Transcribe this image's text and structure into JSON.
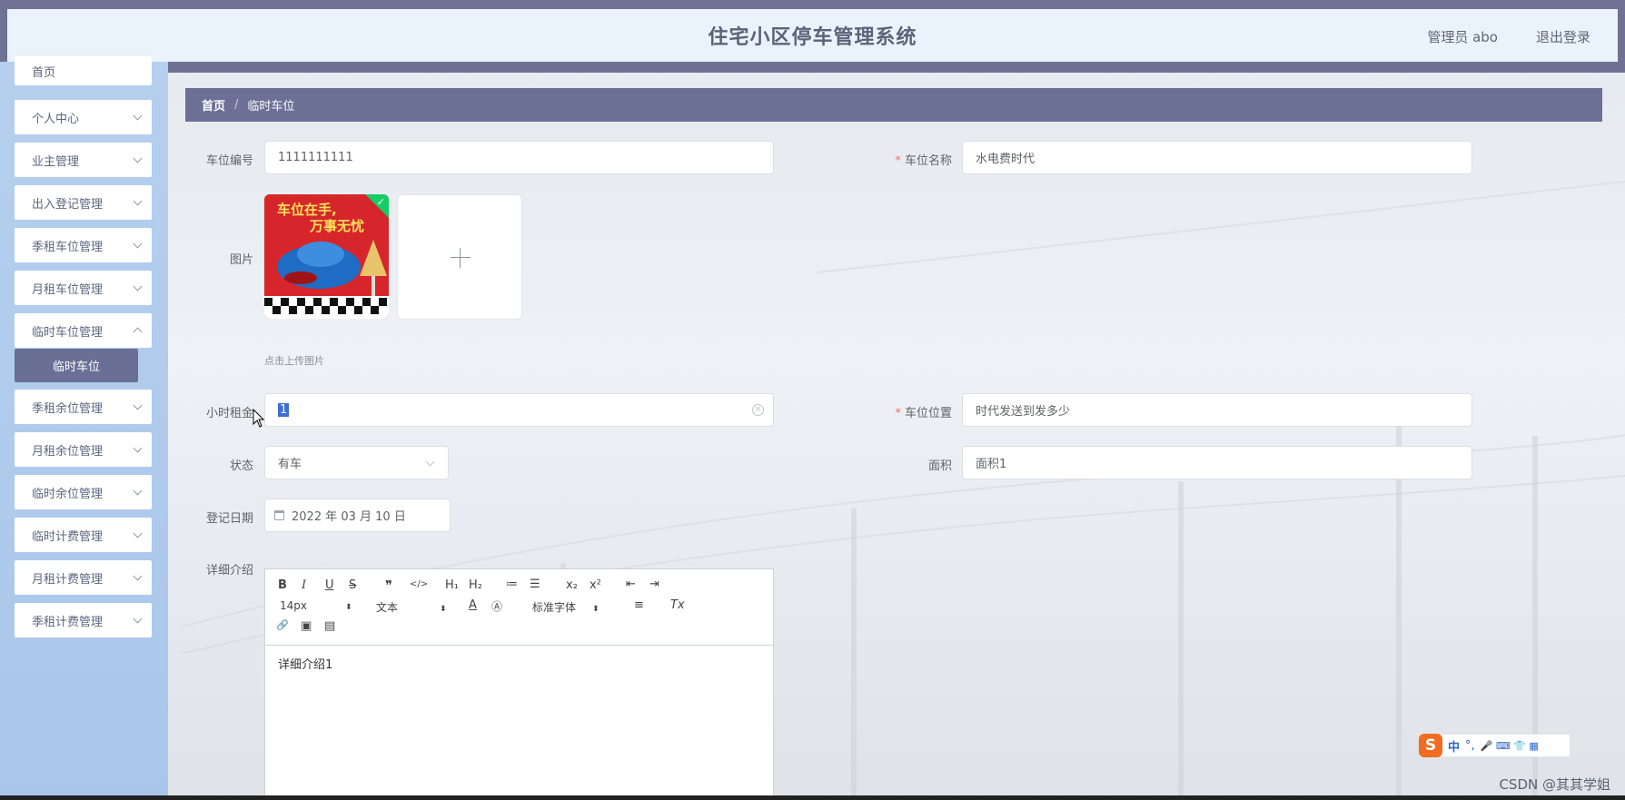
{
  "header": {
    "title": "住宅小区停车管理系统",
    "user": "管理员 abo",
    "logout": "退出登录"
  },
  "sidebar": {
    "items": [
      {
        "label": "首页"
      },
      {
        "label": "个人中心"
      },
      {
        "label": "业主管理"
      },
      {
        "label": "出入登记管理"
      },
      {
        "label": "季租车位管理"
      },
      {
        "label": "月租车位管理"
      },
      {
        "label": "临时车位管理"
      },
      {
        "label": "季租余位管理"
      },
      {
        "label": "月租余位管理"
      },
      {
        "label": "临时余位管理"
      },
      {
        "label": "临时计费管理"
      },
      {
        "label": "月租计费管理"
      },
      {
        "label": "季租计费管理"
      }
    ],
    "active_sub": "临时车位"
  },
  "breadcrumb": {
    "home": "首页",
    "separator": "/",
    "current": "临时车位"
  },
  "form": {
    "spot_no": {
      "label": "车位编号",
      "value": "1111111111"
    },
    "spot_name": {
      "label": "车位名称",
      "value": "水电费时代"
    },
    "image": {
      "label": "图片",
      "hint": "点击上传图片",
      "thumb_line1": "车位在手,",
      "thumb_line2": "万事无忧"
    },
    "hour_rent": {
      "label": "小时租金",
      "value": "1"
    },
    "location": {
      "label": "车位位置",
      "value": "时代发送到发多少"
    },
    "status": {
      "label": "状态",
      "value": "有车"
    },
    "area": {
      "label": "面积",
      "value": "面积1"
    },
    "reg_date": {
      "label": "登记日期",
      "value": "2022 年 03 月 10 日"
    },
    "detail": {
      "label": "详细介绍",
      "value": "详细介绍1"
    }
  },
  "editor_toolbar": {
    "bold": "B",
    "italic": "I",
    "underline": "U",
    "strike": "S",
    "quote": "❞",
    "code": "</>",
    "h1": "H₁",
    "h2": "H₂",
    "ol": "≔",
    "ul": "☰",
    "sub": "x₂",
    "sup": "x²",
    "outdent": "⇤",
    "indent": "⇥",
    "size": "14px",
    "format": "文本",
    "color": "A",
    "bg": "Ⓐ",
    "font": "标准字体",
    "align": "≡",
    "clean": "Tx",
    "link": "🔗",
    "image": "▣",
    "video": "▤"
  },
  "ime": {
    "logo": "S",
    "mode": "中",
    "punct": "°,",
    "icons": "🎤 ⌨ 👕 ▦"
  },
  "watermark": "CSDN @其其学姐",
  "colors": {
    "header_border": "#6f7193",
    "header_bg": "#eaf2fb",
    "sidebar_bg": "#b0cbec",
    "active_sub": "#6a6f96",
    "breadcrumb_bg": "#6d7096",
    "required": "#f56c6c"
  }
}
